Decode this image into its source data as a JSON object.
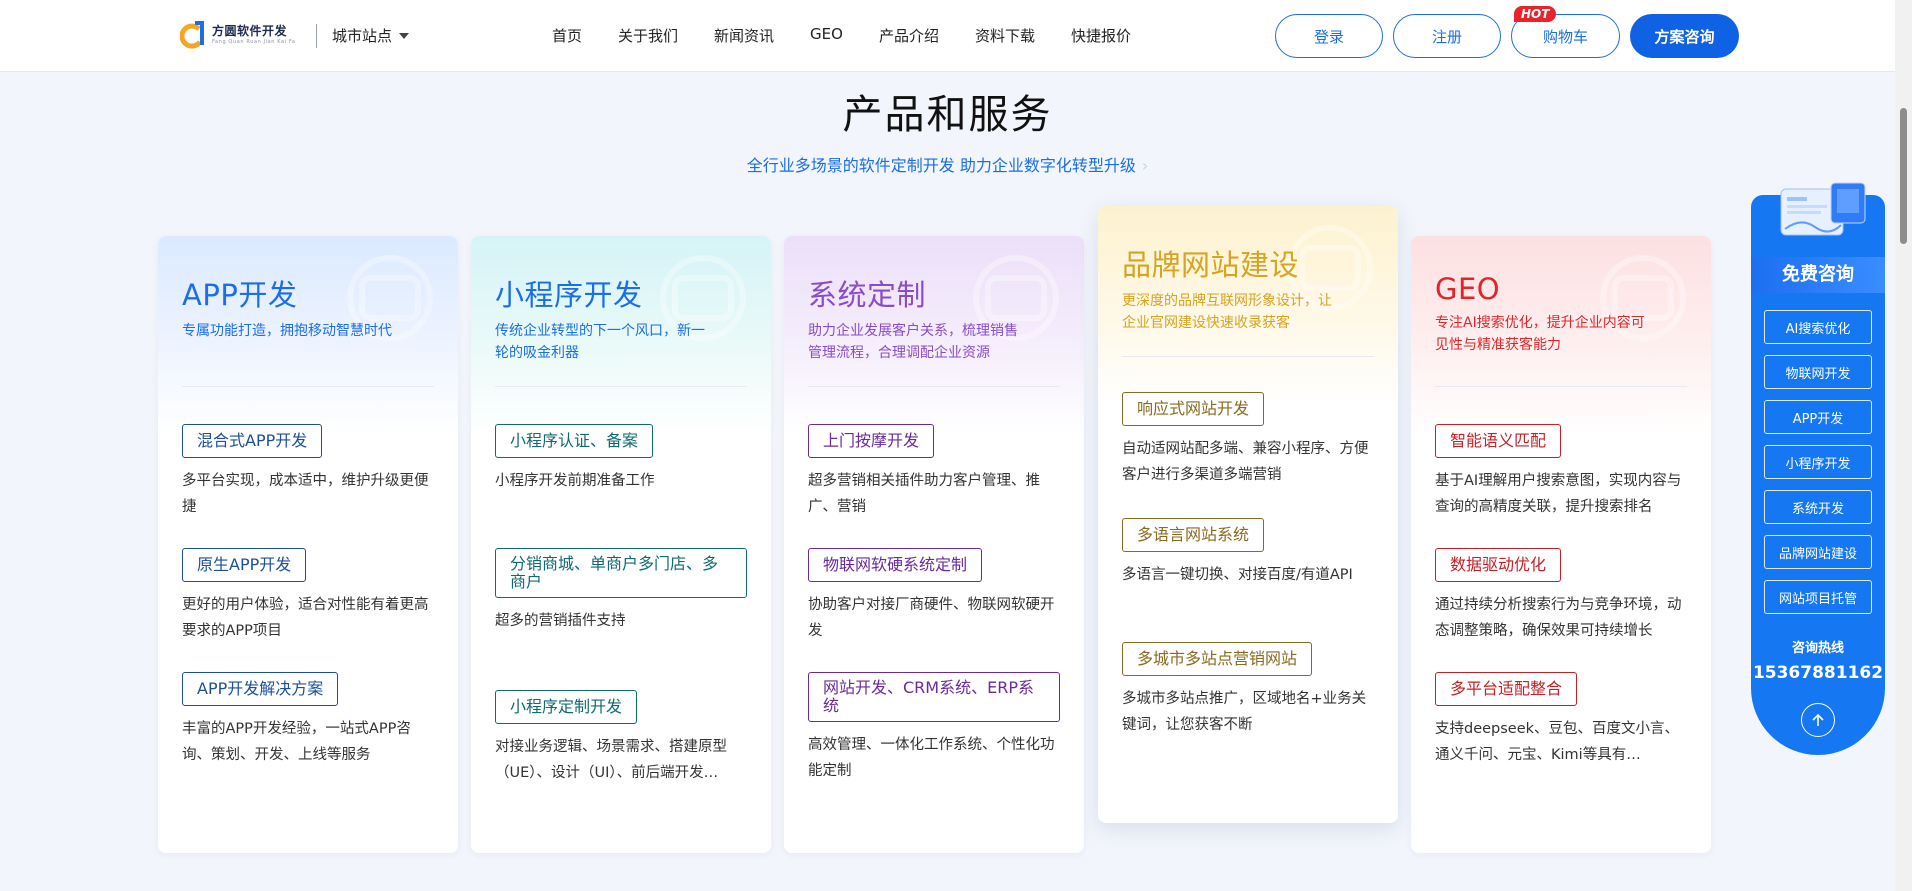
{
  "header": {
    "logo": {
      "name_cn": "方圆软件开发",
      "name_en": "Fang Quan Ruan Jian Kai Fa"
    },
    "city": "城市站点",
    "nav": [
      "首页",
      "关于我们",
      "新闻资讯",
      "GEO",
      "产品介绍",
      "资料下载",
      "快捷报价"
    ],
    "login": "登录",
    "register": "注册",
    "cart": "购物车",
    "hot": "HOT",
    "consult": "方案咨询"
  },
  "section": {
    "title": "产品和服务",
    "subtitle": "全行业多场景的软件定制开发 助力企业数字化转型升级"
  },
  "cards": [
    {
      "title": "APP开发",
      "desc": "专属功能打造，拥抱移动智慧时代",
      "color": "#1a6ee8",
      "tagColor": "#1b4f9c",
      "services": [
        {
          "tag": "混合式APP开发",
          "text": "多平台实现，成本适中，维护升级更便捷"
        },
        {
          "tag": "原生APP开发",
          "text": "更好的用户体验，适合对性能有着更高要求的APP项目"
        },
        {
          "tag": "APP开发解决方案",
          "text": "丰富的APP开发经验，一站式APP咨询、策划、开发、上线等服务"
        }
      ]
    },
    {
      "title": "小程序开发",
      "desc": "传统企业转型的下一个风口，新一轮的吸金利器",
      "color": "#1a6ee8",
      "tagColor": "#0f6b72",
      "services": [
        {
          "tag": "小程序认证、备案",
          "text": "小程序开发前期准备工作"
        },
        {
          "tag": "分销商城、单商户多门店、多商户",
          "text": "超多的营销插件支持"
        },
        {
          "tag": "小程序定制开发",
          "text": "对接业务逻辑、场景需求、搭建原型（UE）、设计（UI）、前后端开发…"
        }
      ]
    },
    {
      "title": "系统定制",
      "desc": "助力企业发展客户关系，梳理销售管理流程，合理调配企业资源",
      "color": "#8a4cc8",
      "tagColor": "#6a2a9e",
      "services": [
        {
          "tag": "上门按摩开发",
          "text": "超多营销相关插件助力客户管理、推广、营销"
        },
        {
          "tag": "物联网软硬系统定制",
          "text": "协助客户对接厂商硬件、物联网软硬开发"
        },
        {
          "tag": "网站开发、CRM系统、ERP系统",
          "text": "高效管理、一体化工作系统、个性化功能定制"
        }
      ]
    },
    {
      "title": "品牌网站建设",
      "desc": "更深度的品牌互联网形象设计，让企业官网建设快速收录获客",
      "color": "#d7a321",
      "tagColor": "#8a6a1e",
      "services": [
        {
          "tag": "响应式网站开发",
          "text": "自动适网站配多端、兼容小程序、方便客户进行多渠道多端营销"
        },
        {
          "tag": "多语言网站系统",
          "text": "多语言一键切换、对接百度/有道API"
        },
        {
          "tag": "多城市多站点营销网站",
          "text": "多城市多站点推广，区域地名+业务关键词，让您获客不断"
        }
      ]
    },
    {
      "title": "GEO",
      "desc": "专注AI搜索优化，提升企业内容可见性与精准获客能力",
      "color": "#e0262b",
      "tagColor": "#c81e24",
      "services": [
        {
          "tag": "智能语义匹配",
          "text": "基于AI理解用户搜索意图，实现内容与查询的高精度关联，提升搜索排名"
        },
        {
          "tag": "数据驱动优化",
          "text": "通过持续分析搜索行为与竞争环境，动态调整策略，确保效果可持续增长"
        },
        {
          "tag": "多平台适配整合",
          "text": "支持deepseek、豆包、百度文小言、通义千问、元宝、Kimi等具有…"
        }
      ]
    }
  ],
  "side": {
    "title": "免费咨询",
    "items": [
      "AI搜索优化",
      "物联网开发",
      "APP开发",
      "小程序开发",
      "系统开发",
      "品牌网站建设",
      "网站项目托管"
    ],
    "hotline_label": "咨询热线",
    "phone": "15367881162"
  }
}
